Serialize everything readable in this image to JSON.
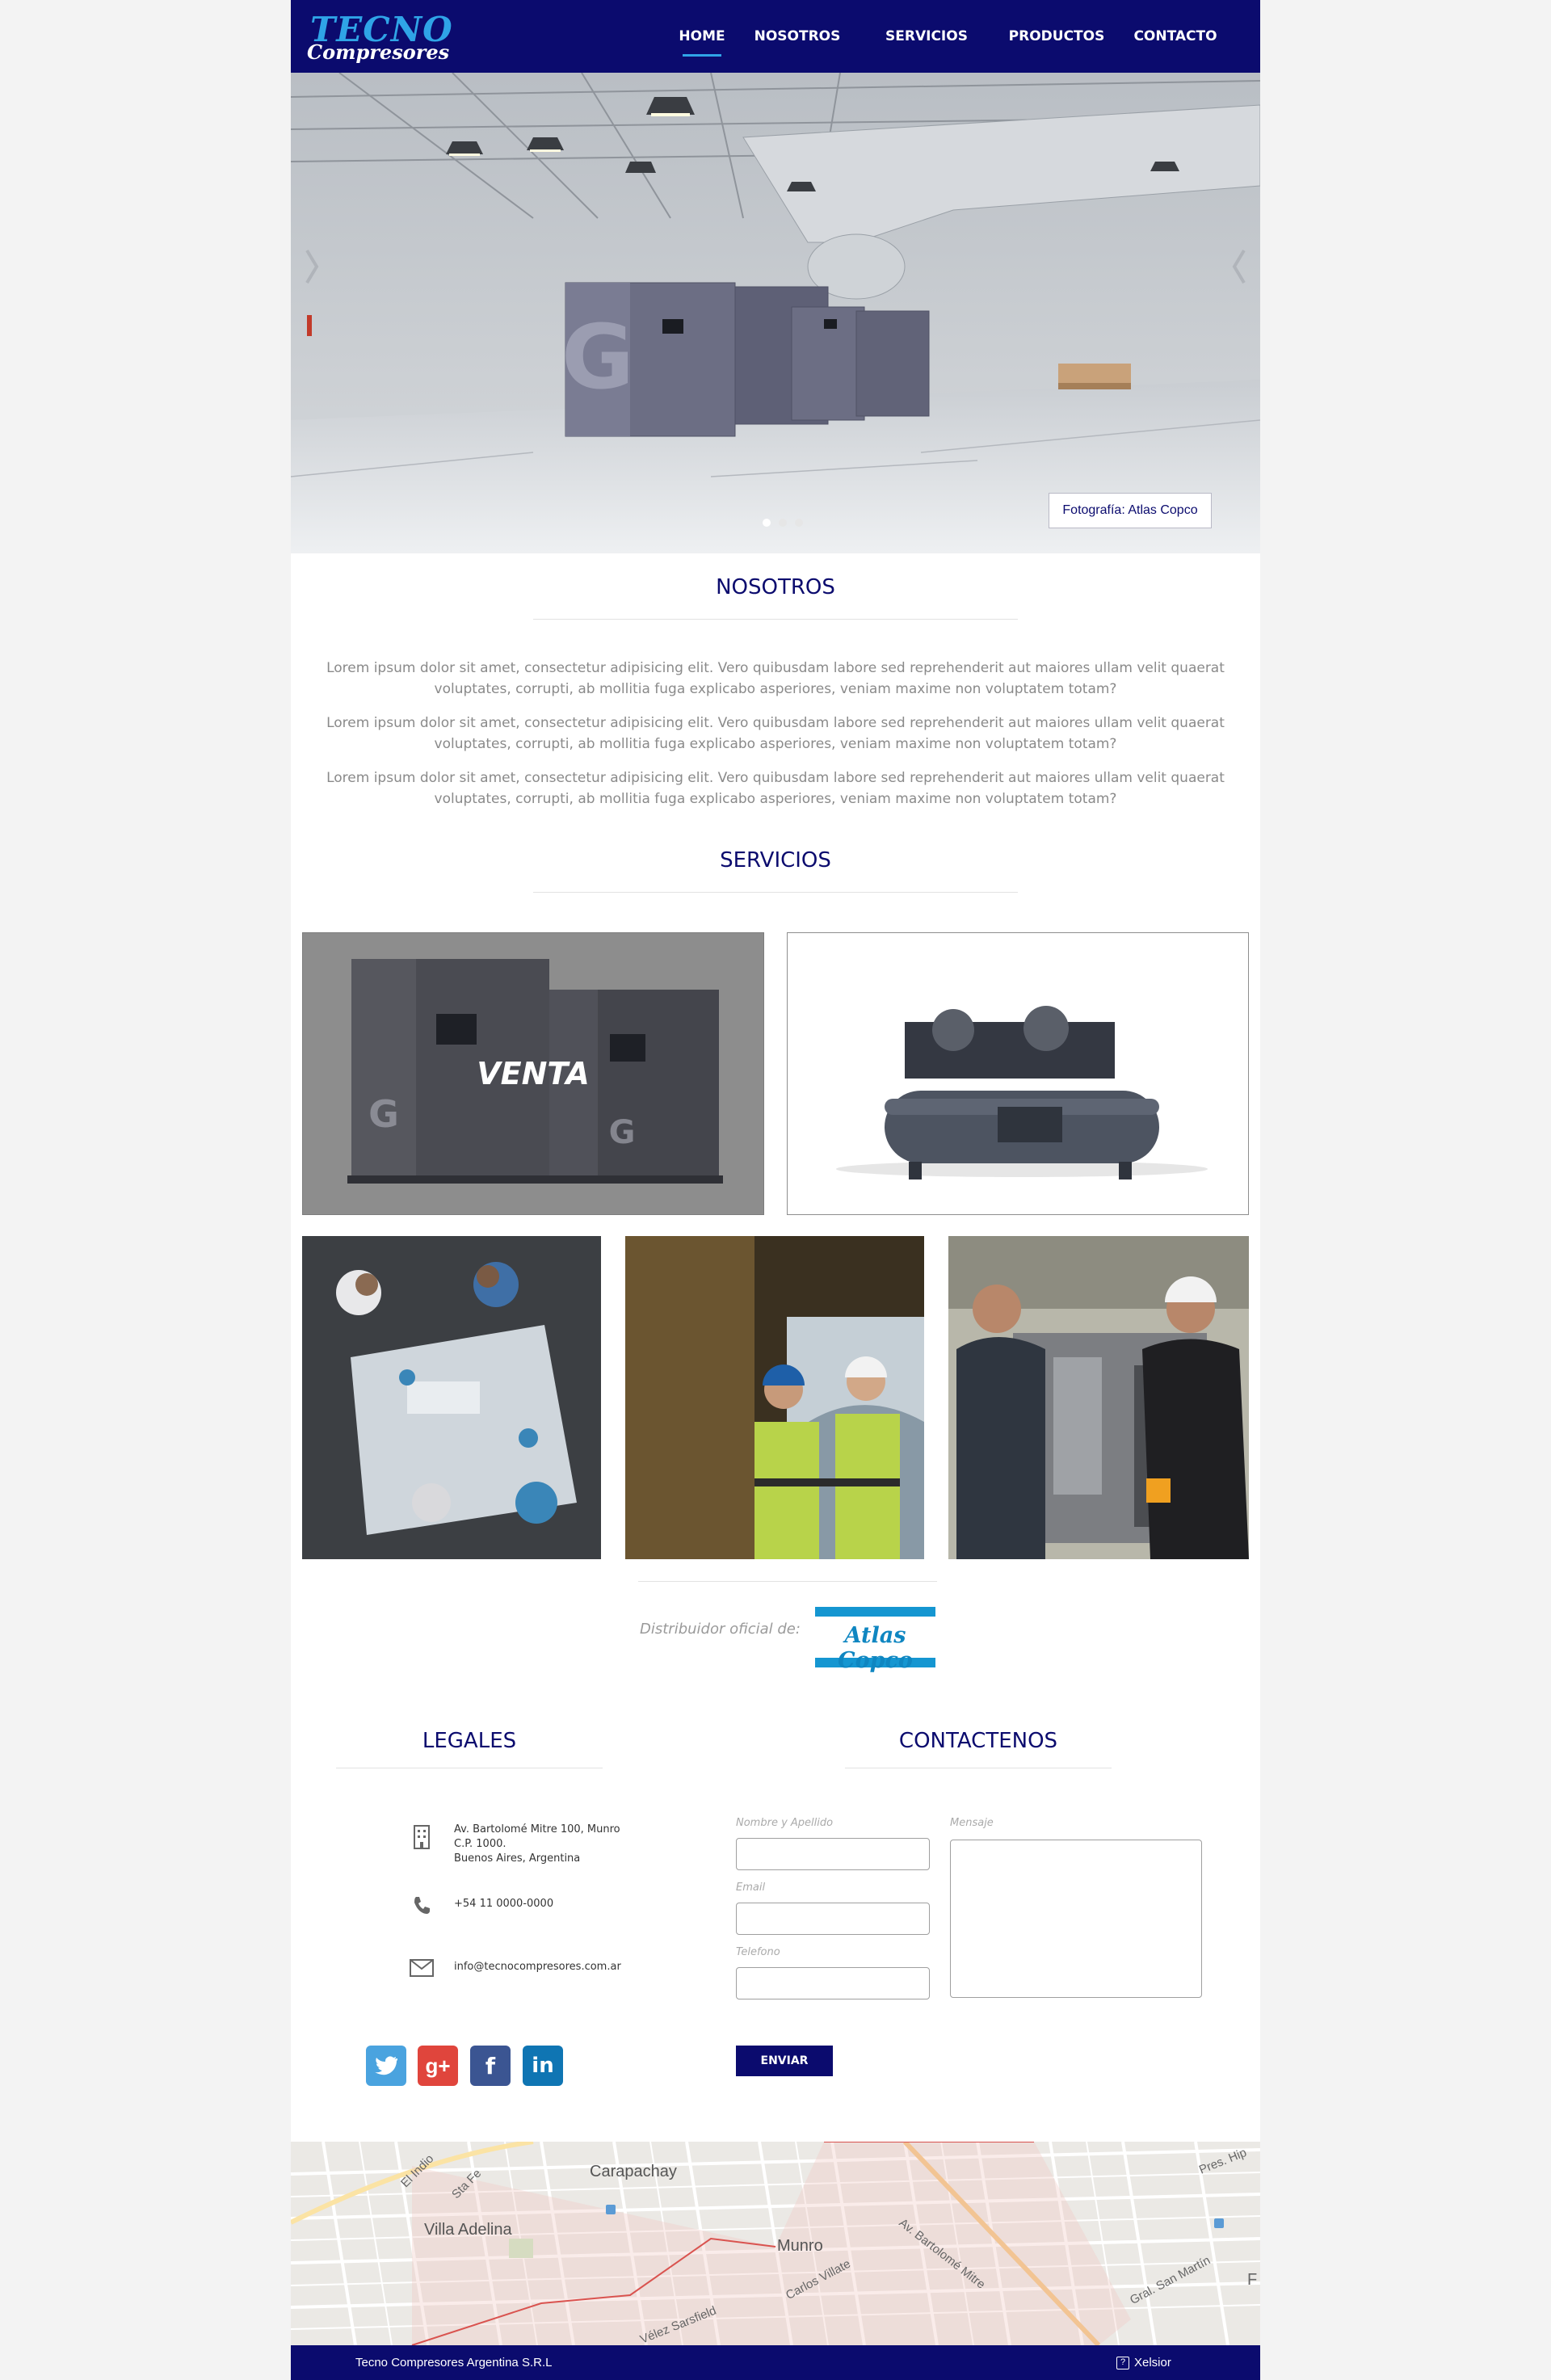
{
  "brand": {
    "logo_top": "TECNO",
    "logo_bottom": "Compresores"
  },
  "nav": {
    "items": [
      {
        "label": "HOME",
        "active": true
      },
      {
        "label": "NOSOTROS",
        "active": false
      },
      {
        "label": "SERVICIOS",
        "active": false
      },
      {
        "label": "PRODUCTOS",
        "active": false
      },
      {
        "label": "CONTACTO",
        "active": false
      }
    ]
  },
  "hero": {
    "caption": "Fotografía: Atlas Copco",
    "slides_total": 3,
    "current_slide": 1
  },
  "nosotros": {
    "title": "NOSOTROS",
    "paragraphs": [
      "Lorem ipsum dolor sit amet, consectetur adipisicing elit. Vero quibusdam labore sed reprehenderit aut maiores ullam velit quaerat voluptates, corrupti, ab mollitia fuga explicabo asperiores, veniam maxime non voluptatem totam?",
      "Lorem ipsum dolor sit amet, consectetur adipisicing elit. Vero quibusdam labore sed reprehenderit aut maiores ullam velit quaerat voluptates, corrupti, ab mollitia fuga explicabo asperiores, veniam maxime non voluptatem totam?",
      "Lorem ipsum dolor sit amet, consectetur adipisicing elit. Vero quibusdam labore sed reprehenderit aut maiores ullam velit quaerat voluptates, corrupti, ab mollitia fuga explicabo asperiores, veniam maxime non voluptatem totam?"
    ]
  },
  "servicios": {
    "title": "SERVICIOS",
    "venta_label": "VENTA"
  },
  "distributor": {
    "text": "Distribuidor oficial de:",
    "brand": "Atlas Copco"
  },
  "legales": {
    "title": "LEGALES",
    "address_lines": [
      "Av. Bartolomé Mitre 100, Munro",
      "C.P. 1000.",
      "Buenos Aires, Argentina"
    ],
    "phone": "+54 11 0000-0000",
    "email": "info@tecnocompresores.com.ar"
  },
  "contact": {
    "title": "CONTACTENOS",
    "name_label": "Nombre y Apellido",
    "email_label": "Email",
    "phone_label": "Telefono",
    "message_label": "Mensaje",
    "submit_label": "ENVIAR"
  },
  "map": {
    "labels": [
      "Carapachay",
      "Villa Adelina",
      "Munro",
      "El Indio",
      "Sta Fe",
      "Av. Bartolomé Mitre",
      "Carlos Villate",
      "Vélez Sarsfield",
      "Gral. San Martín",
      "Pres. Hip",
      "F"
    ]
  },
  "footer": {
    "left": "Tecno Compresores Argentina S.R.L",
    "right": "Xelsior"
  },
  "colors": {
    "navy": "#0b0b6e",
    "accent": "#2fa4e7"
  }
}
